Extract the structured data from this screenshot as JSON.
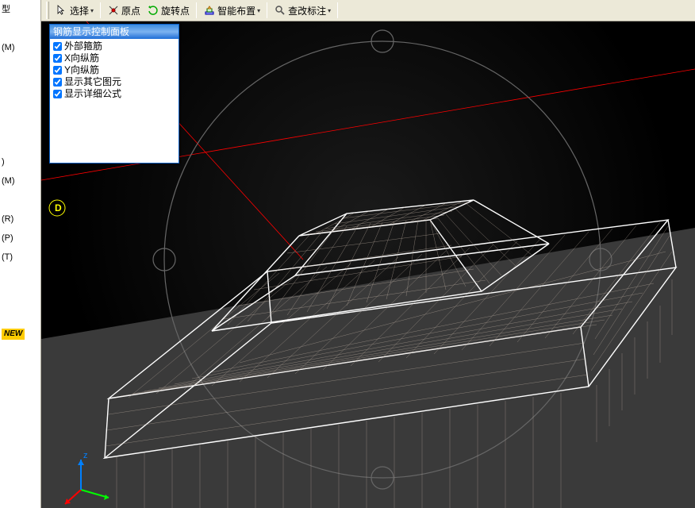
{
  "left_panel": {
    "rows": [
      "型",
      "",
      "(M)",
      "",
      "",
      "",
      "",
      "",
      ")",
      "(M)",
      "",
      "(R)",
      "(P)",
      "(T)",
      "",
      "",
      "",
      "NEW"
    ]
  },
  "toolbar": {
    "select_label": "选择",
    "origin_label": "原点",
    "rotate_label": "旋转点",
    "smart_label": "智能布置",
    "annotate_label": "查改标注"
  },
  "control_panel": {
    "title": "钢筋显示控制面板",
    "items": [
      {
        "label": "外部箍筋",
        "checked": true
      },
      {
        "label": "X向纵筋",
        "checked": true
      },
      {
        "label": "Y向纵筋",
        "checked": true
      },
      {
        "label": "显示其它图元",
        "checked": true
      },
      {
        "label": "显示详细公式",
        "checked": true
      }
    ]
  },
  "viewport": {
    "axis_label": "D",
    "axis_z": "z"
  }
}
